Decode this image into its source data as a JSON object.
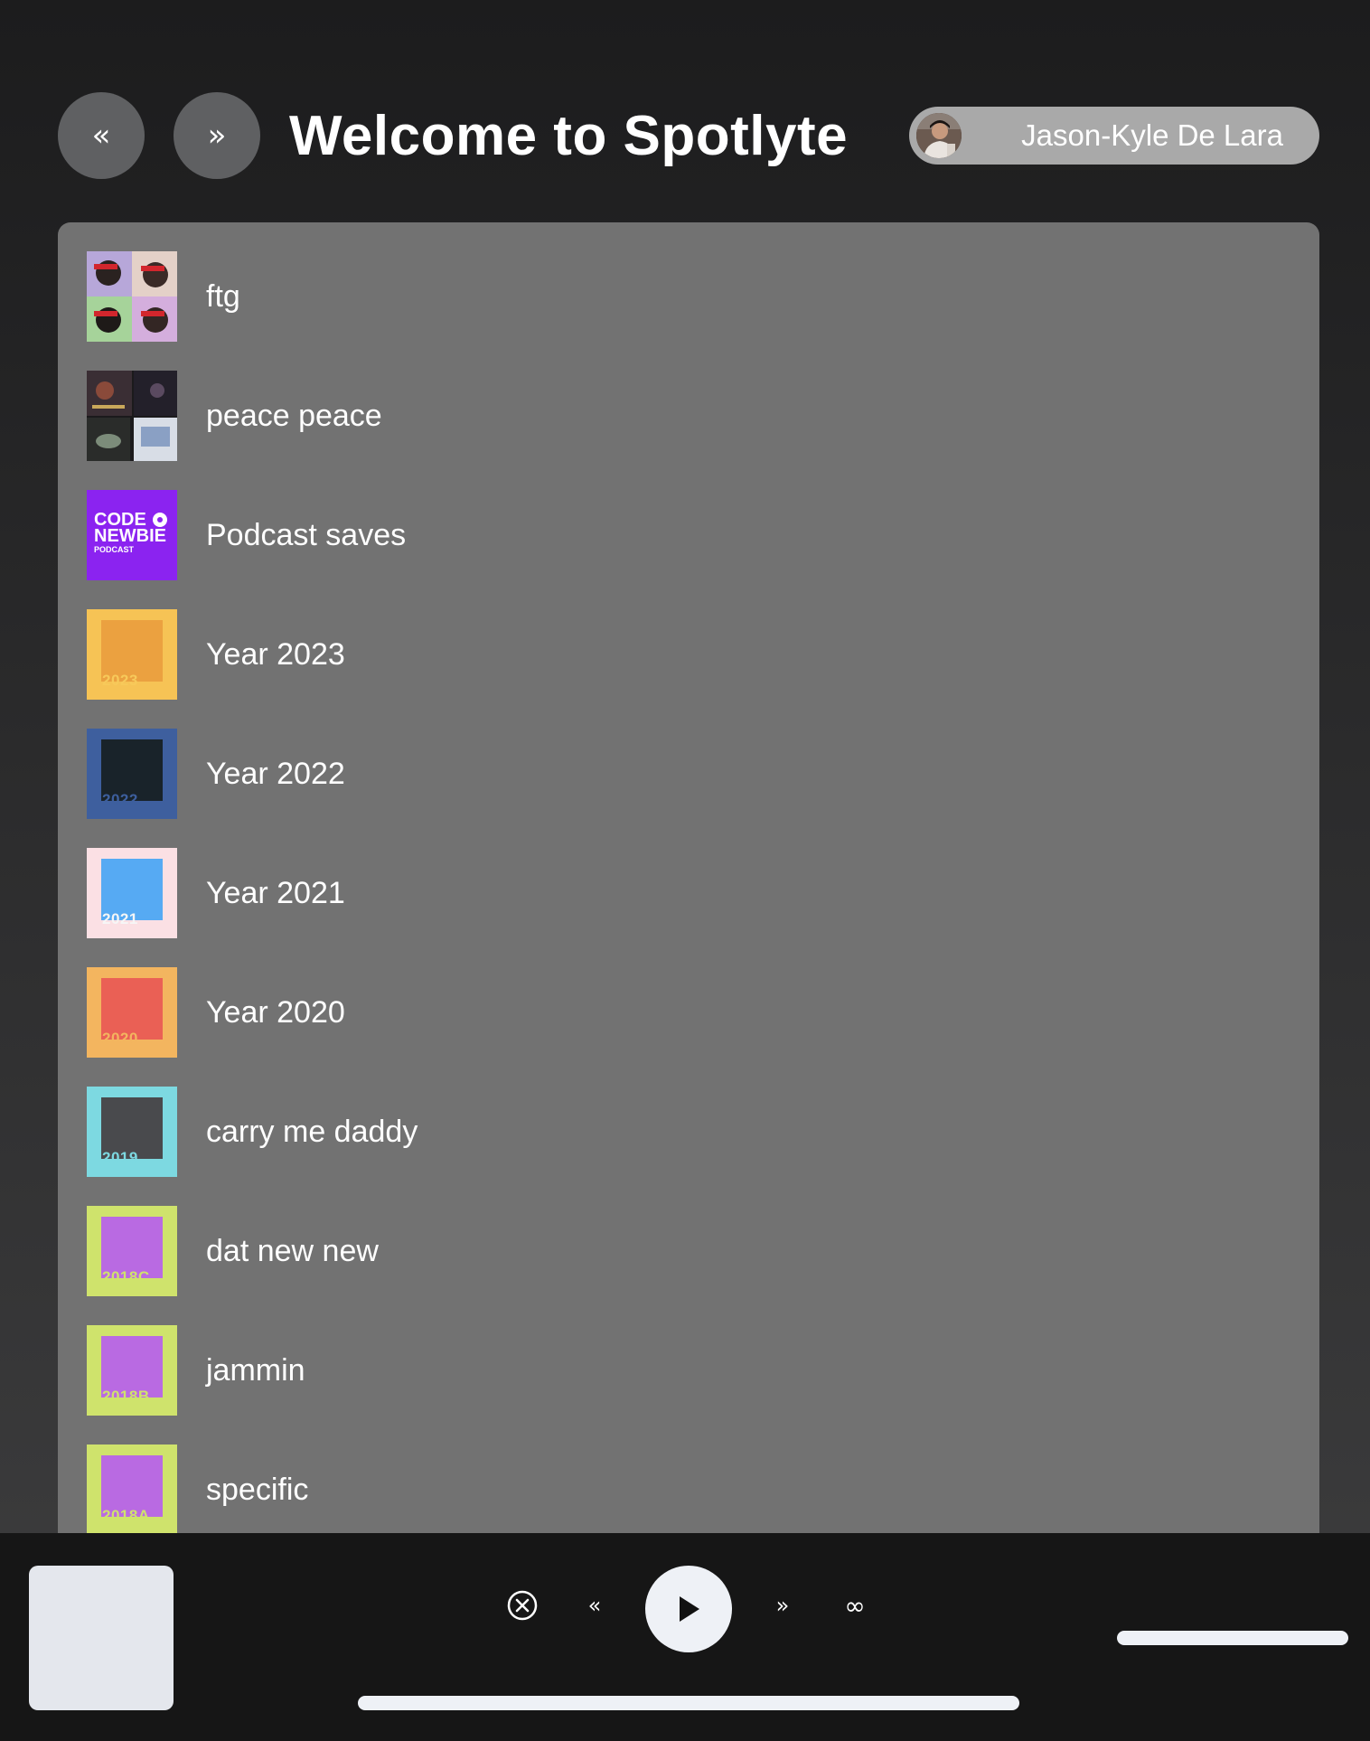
{
  "header": {
    "back_icon": "«",
    "forward_icon": "»",
    "title": "Welcome to Spotlyte",
    "user_name": "Jason-Kyle De Lara"
  },
  "playlists": [
    {
      "name": "ftg",
      "art": "collage-faces"
    },
    {
      "name": "peace peace",
      "art": "collage-dark"
    },
    {
      "name": "Podcast saves",
      "art": "codenewbie",
      "art_text": [
        "CODE",
        "NEWBIE",
        "PODCAST"
      ]
    },
    {
      "name": "Year 2023",
      "art": "year",
      "year": "2023",
      "outer": "#f6c355",
      "inner": "#eba140",
      "label_color": "#f7c95a"
    },
    {
      "name": "Year 2022",
      "art": "year",
      "year": "2022",
      "outer": "#3e5f9e",
      "inner": "#19232a",
      "label_color": "#3d5f9e"
    },
    {
      "name": "Year 2021",
      "art": "year",
      "year": "2021",
      "outer": "#fbe0e4",
      "inner": "#56aaf3",
      "label_color": "#f6f6f6"
    },
    {
      "name": "Year 2020",
      "art": "year",
      "year": "2020",
      "outer": "#f3b55f",
      "inner": "#ea6055",
      "label_color": "#f3b55f"
    },
    {
      "name": "carry me daddy",
      "art": "year",
      "year": "2019",
      "outer": "#7dd9e1",
      "inner": "#494a4d",
      "label_color": "#7dd9e1"
    },
    {
      "name": "dat new new",
      "art": "year",
      "year": "2018C",
      "outer": "#cfe36c",
      "inner": "#b96ae2",
      "label_color": "#cfe36c"
    },
    {
      "name": "jammin",
      "art": "year",
      "year": "2018B",
      "outer": "#cfe36c",
      "inner": "#b96ae2",
      "label_color": "#cfe36c"
    },
    {
      "name": "specific",
      "art": "year",
      "year": "2018A",
      "outer": "#cfe36c",
      "inner": "#b96ae2",
      "label_color": "#cfe36c"
    }
  ],
  "player": {
    "prev_icon": "«",
    "next_icon": "»",
    "loop_icon": "∞"
  },
  "colors": {
    "panel": "#727272",
    "player_bg": "#161616",
    "control_light": "#eef1f6"
  }
}
